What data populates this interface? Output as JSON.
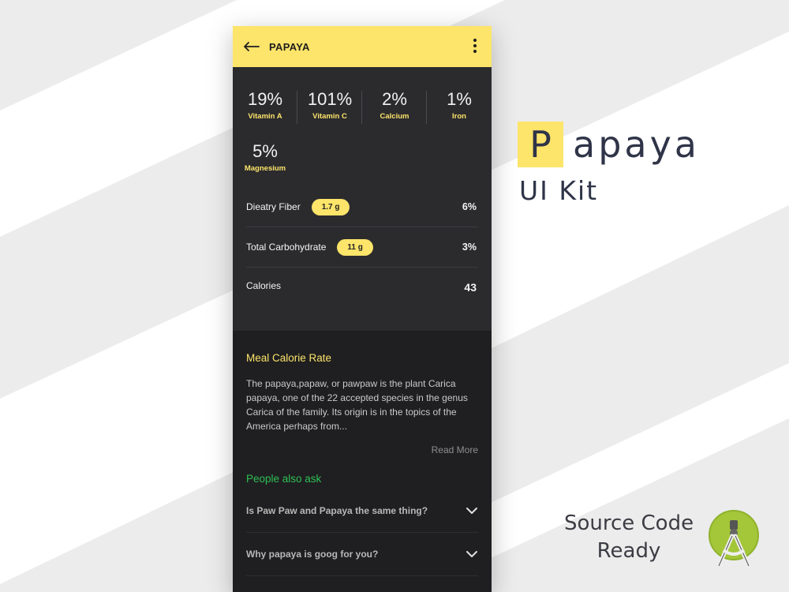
{
  "app": {
    "title": "PAPAYA"
  },
  "nutrients": [
    {
      "value": "19%",
      "label": "Vitamin A"
    },
    {
      "value": "101%",
      "label": "Vitamin C"
    },
    {
      "value": "2%",
      "label": "Calcium"
    },
    {
      "value": "1%",
      "label": "Iron"
    },
    {
      "value": "5%",
      "label": "Magnesium"
    }
  ],
  "stats": [
    {
      "label": "Dieatry Fiber",
      "pill": "1.7 g",
      "value": "6%"
    },
    {
      "label": "Total Carbohydrate",
      "pill": "11 g",
      "value": "3%"
    },
    {
      "label": "Calories",
      "value": "43"
    }
  ],
  "meal": {
    "title": "Meal Calorie Rate",
    "description": "The papaya,papaw, or pawpaw is the plant Carica papaya, one of the 22 accepted species in the genus Carica of the family. Its origin is in the topics of the America perhaps from...",
    "read_more": "Read More"
  },
  "ask": {
    "title": "People also ask",
    "questions": [
      "Is Paw Paw and Papaya the same thing?",
      "Why papaya is goog for you?"
    ]
  },
  "promo": {
    "brand_first_letter": "P",
    "brand_rest": "apaya",
    "subtitle": "UI Kit",
    "source_line1": "Source Code",
    "source_line2": "Ready"
  },
  "colors": {
    "accent": "#fde46a",
    "phone_bg": "#2b2b2e",
    "lower_bg": "#1f1f21",
    "green": "#2fbf55",
    "android_green": "#a4c639"
  },
  "icons": [
    "back-arrow-icon",
    "more-vert-icon",
    "chevron-down-icon",
    "android-studio-icon"
  ]
}
